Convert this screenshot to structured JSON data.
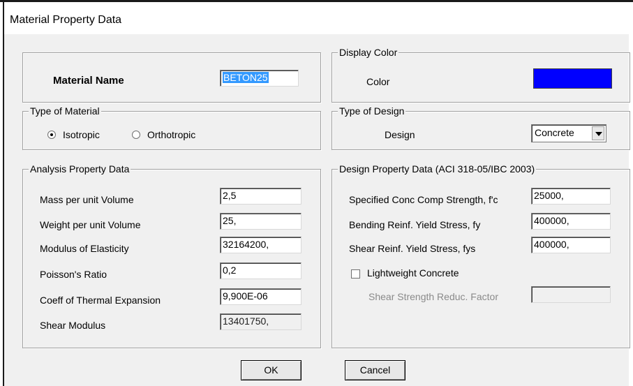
{
  "window": {
    "title": "Material Property Data"
  },
  "material_name": {
    "label": "Material Name",
    "value": "BETON25"
  },
  "display_color": {
    "legend": "Display Color",
    "label": "Color",
    "color": "#0000ff"
  },
  "type_of_material": {
    "legend": "Type of Material",
    "options": [
      {
        "label": "Isotropic",
        "selected": true
      },
      {
        "label": "Orthotropic",
        "selected": false
      }
    ]
  },
  "type_of_design": {
    "legend": "Type of Design",
    "label": "Design",
    "value": "Concrete"
  },
  "analysis": {
    "legend": "Analysis Property Data",
    "rows": [
      {
        "label": "Mass per unit Volume",
        "value": "2,5"
      },
      {
        "label": "Weight per unit Volume",
        "value": "25,"
      },
      {
        "label": "Modulus of Elasticity",
        "value": "32164200,"
      },
      {
        "label": "Poisson's Ratio",
        "value": "0,2"
      },
      {
        "label": "Coeff of Thermal Expansion",
        "value": "9,900E-06"
      },
      {
        "label": "Shear Modulus",
        "value": "13401750,"
      }
    ]
  },
  "design": {
    "legend": "Design Property Data (ACI 318-05/IBC 2003)",
    "rows": [
      {
        "label": "Specified Conc Comp Strength, f'c",
        "value": "25000,"
      },
      {
        "label": "Bending Reinf. Yield Stress, fy",
        "value": "400000,"
      },
      {
        "label": "Shear Reinf. Yield Stress, fys",
        "value": "400000,"
      }
    ],
    "lightweight_label": "Lightweight Concrete",
    "lightweight_checked": false,
    "shear_reduc_label": "Shear Strength Reduc. Factor",
    "shear_reduc_value": ""
  },
  "buttons": {
    "ok": "OK",
    "cancel": "Cancel"
  }
}
